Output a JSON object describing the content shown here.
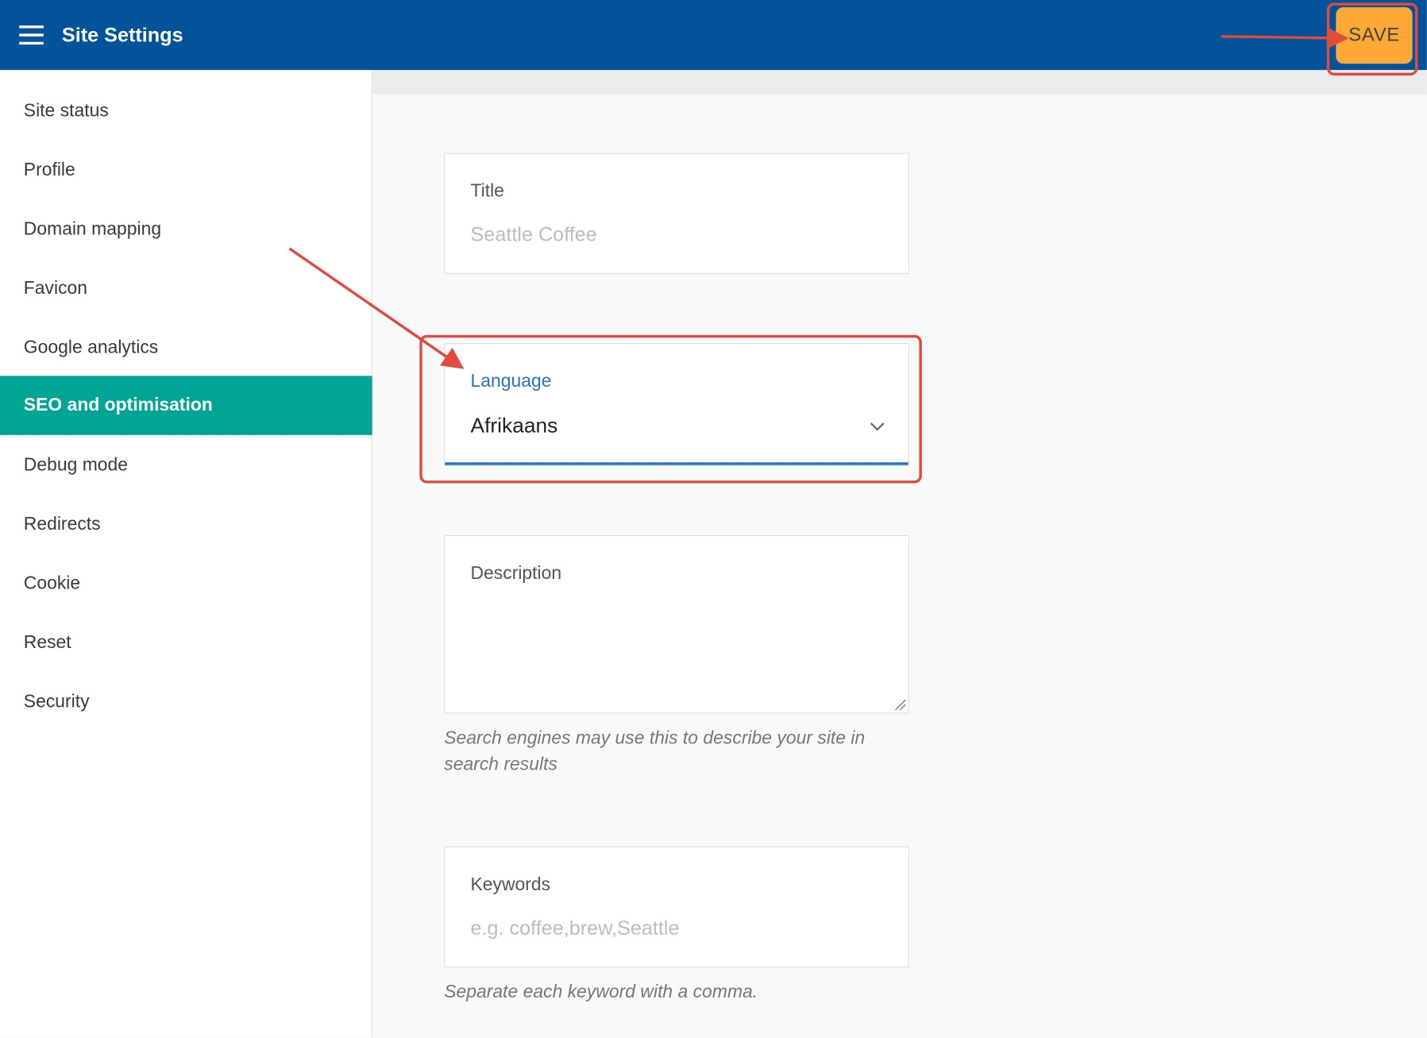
{
  "header": {
    "title": "Site Settings",
    "save_label": "SAVE"
  },
  "sidebar": {
    "items": [
      {
        "label": "Site status"
      },
      {
        "label": "Profile"
      },
      {
        "label": "Domain mapping"
      },
      {
        "label": "Favicon"
      },
      {
        "label": "Google analytics"
      },
      {
        "label": "SEO and optimisation",
        "active": true
      },
      {
        "label": "Debug mode"
      },
      {
        "label": "Redirects"
      },
      {
        "label": "Cookie"
      },
      {
        "label": "Reset"
      },
      {
        "label": "Security"
      }
    ]
  },
  "form": {
    "title": {
      "label": "Title",
      "placeholder": "Seattle Coffee"
    },
    "language": {
      "label": "Language",
      "value": "Afrikaans"
    },
    "description": {
      "label": "Description",
      "value": "",
      "helper": "Search engines may use this to describe your site in search results"
    },
    "keywords": {
      "label": "Keywords",
      "placeholder": "e.g. coffee,brew,Seattle",
      "helper": "Separate each keyword with a comma."
    }
  },
  "colors": {
    "header": "#03539b",
    "active_nav": "#00a596",
    "save_button": "#ffa836",
    "accent": "#2673c9",
    "annotation": "#e04b3c"
  },
  "icons": {
    "menu": "hamburger-icon",
    "dropdown": "chevron-down-icon",
    "resize": "resize-handle-icon"
  }
}
